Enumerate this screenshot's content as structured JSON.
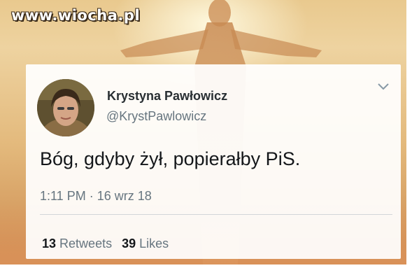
{
  "watermark": "www.wiocha.pl",
  "tweet": {
    "author_name": "Krystyna Pawłowicz",
    "author_handle": "@KrystPawlowicz",
    "text": "Bóg, gdyby żył, popierałby PiS.",
    "time": "1:11 PM",
    "separator": "·",
    "date": "16 wrz 18",
    "retweets_count": "13",
    "retweets_label": "Retweets",
    "likes_count": "39",
    "likes_label": "Likes"
  },
  "icons": {
    "menu": "chevron-down-icon",
    "avatar": "avatar"
  },
  "colors": {
    "name": "#292f33",
    "secondary_text": "#66757f",
    "tweet_text": "#14171a",
    "background_glow": "#e9c98e"
  }
}
